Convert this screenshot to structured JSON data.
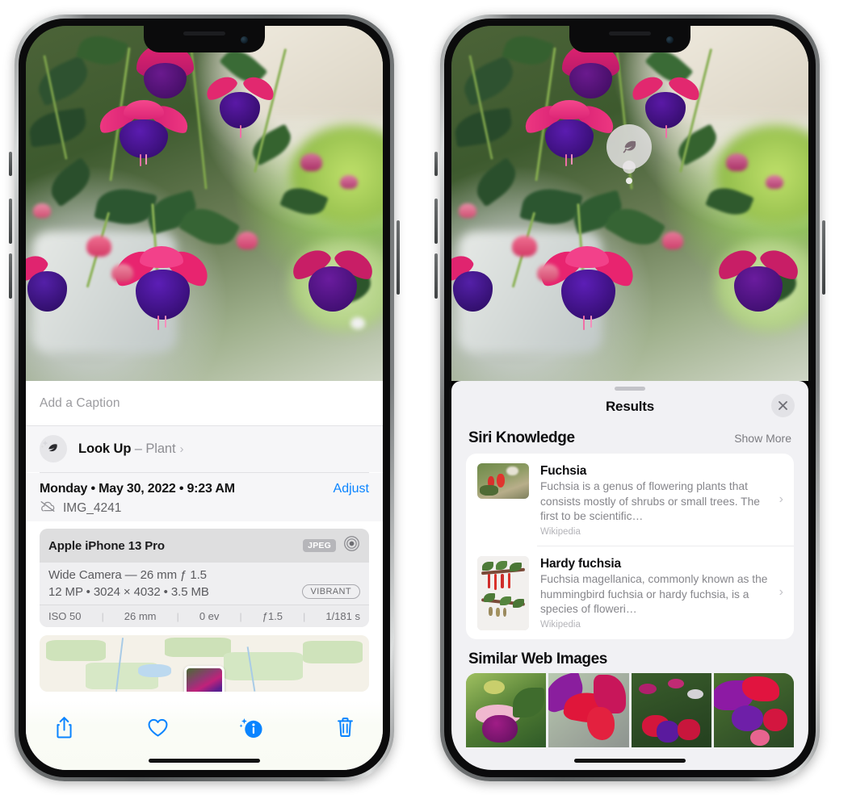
{
  "meta": {
    "accent_blue": "#0a84ff",
    "sheet_bg": "#f1f1f4",
    "card_bg": "#ffffff"
  },
  "left_phone": {
    "name": "photos-detail-screen",
    "caption": {
      "placeholder": "Add a Caption",
      "value": ""
    },
    "lookup": {
      "icon": "leaf-icon",
      "label": "Look Up",
      "dash": "–",
      "subject": "Plant",
      "chevron": "›"
    },
    "info": {
      "date_line": "Monday • May 30, 2022 • 9:23 AM",
      "adjust_label": "Adjust",
      "cloud_icon": "cloud-slash-icon",
      "filename": "IMG_4241"
    },
    "camera_card": {
      "device": "Apple iPhone 13 Pro",
      "format_badge": "JPEG",
      "lens_icon": "aperture-icon",
      "lens_line": "Wide Camera — 26 mm ƒ 1.5",
      "specs_line": "12 MP • 3024 × 4032 • 3.5 MB",
      "style_badge": "VIBRANT",
      "exif": [
        "ISO 50",
        "26 mm",
        "0 ev",
        "ƒ1.5",
        "1/181 s"
      ]
    },
    "map": {
      "name": "location-map",
      "pin_label": "photo-thumbnail-pin"
    },
    "toolbar": [
      {
        "name": "share-button",
        "icon": "share-icon",
        "label": "Share"
      },
      {
        "name": "favorite-button",
        "icon": "heart-icon",
        "label": "Favorite"
      },
      {
        "name": "info-button",
        "icon": "info-sparkle-icon",
        "label": "Info",
        "active": true
      },
      {
        "name": "delete-button",
        "icon": "trash-icon",
        "label": "Delete"
      }
    ]
  },
  "right_phone": {
    "name": "visual-lookup-results-screen",
    "badge": {
      "icon": "leaf-icon",
      "label": "Plant lookup badge"
    },
    "sheet": {
      "title": "Results",
      "close_icon": "close-icon",
      "sections": [
        {
          "title": "Siri Knowledge",
          "action": "Show More",
          "items": [
            {
              "title": "Fuchsia",
              "description": "Fuchsia is a genus of flowering plants that consists mostly of shrubs or small trees. The first to be scientific…",
              "source": "Wikipedia",
              "thumb": "fuchsia-red-flowers-thumbnail",
              "chevron": "›"
            },
            {
              "title": "Hardy fuchsia",
              "description": "Fuchsia magellanica, commonly known as the hummingbird fuchsia or hardy fuchsia, is a species of floweri…",
              "source": "Wikipedia",
              "thumb": "hardy-fuchsia-specimen-thumbnail",
              "chevron": "›"
            }
          ]
        },
        {
          "title": "Similar Web Images",
          "action": "",
          "images": [
            "fuchsia-web-image-1",
            "fuchsia-web-image-2",
            "fuchsia-web-image-3",
            "fuchsia-web-image-4"
          ]
        }
      ]
    }
  }
}
